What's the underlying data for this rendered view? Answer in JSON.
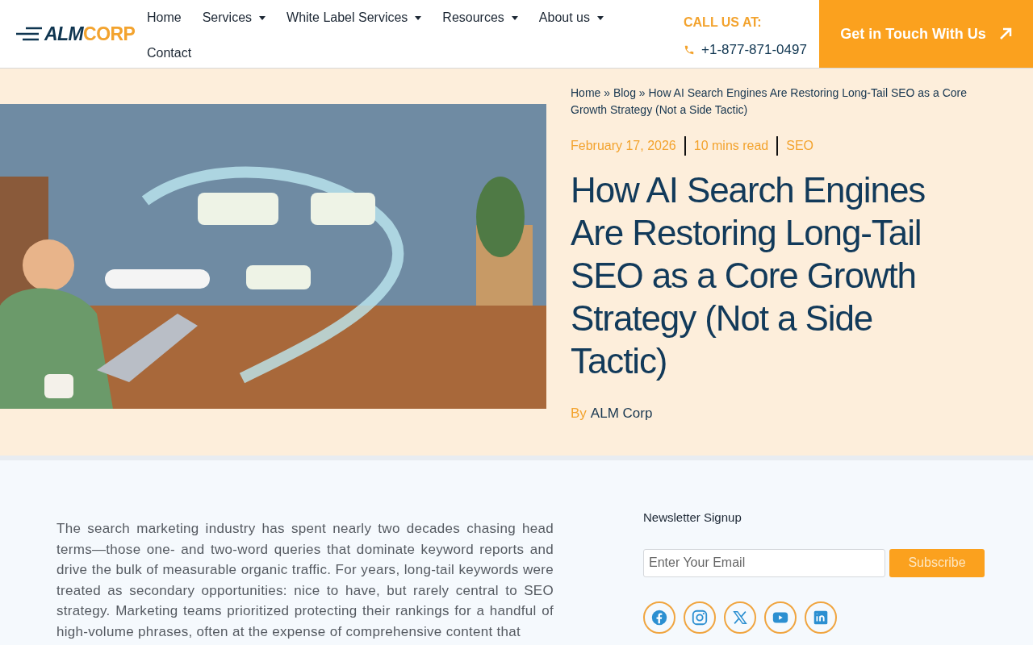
{
  "header": {
    "logo": {
      "part_1": "ALM",
      "part_2": "CORP"
    },
    "nav": [
      {
        "label": "Home",
        "dropdown": false
      },
      {
        "label": "Services",
        "dropdown": true
      },
      {
        "label": "White Label Services",
        "dropdown": true
      },
      {
        "label": "Resources",
        "dropdown": true
      },
      {
        "label": "About us",
        "dropdown": true
      },
      {
        "label": "Contact",
        "dropdown": false
      }
    ],
    "call_label": "CALL US AT:",
    "phone": "+1-877-871-0497",
    "cta": "Get in Touch With Us"
  },
  "hero": {
    "breadcrumb_separator": "»",
    "breadcrumb": [
      "Home",
      "Blog",
      "How AI Search Engines Are Restoring Long-Tail SEO as a Core Growth Strategy (Not a Side Tactic)"
    ],
    "meta": [
      "February 17, 2026",
      "10 mins read",
      "SEO"
    ],
    "title": "How AI Search Engines Are Restoring Long-Tail SEO as a Core Growth Strategy (Not a Side Tactic)",
    "byline_label": "By",
    "author": "ALM Corp"
  },
  "article": {
    "paragraph": "The search marketing industry has spent nearly two decades chasing head terms—those one- and two-word queries that dominate keyword reports and drive the bulk of measurable organic traffic. For years, long-tail keywords were treated as secondary opportunities: nice to have, but rarely central to SEO strategy. Marketing teams prioritized protecting their rankings for a handful of high-volume phrases, often at the expense of comprehensive content that"
  },
  "sidebar": {
    "heading": "Newsletter Signup",
    "email": {
      "placeholder": "Enter Your Email"
    },
    "button": "Subscribe",
    "social": [
      {
        "kind": "facebook"
      },
      {
        "kind": "instagram"
      },
      {
        "kind": "x"
      },
      {
        "kind": "youtube"
      },
      {
        "kind": "linkedin"
      }
    ]
  }
}
